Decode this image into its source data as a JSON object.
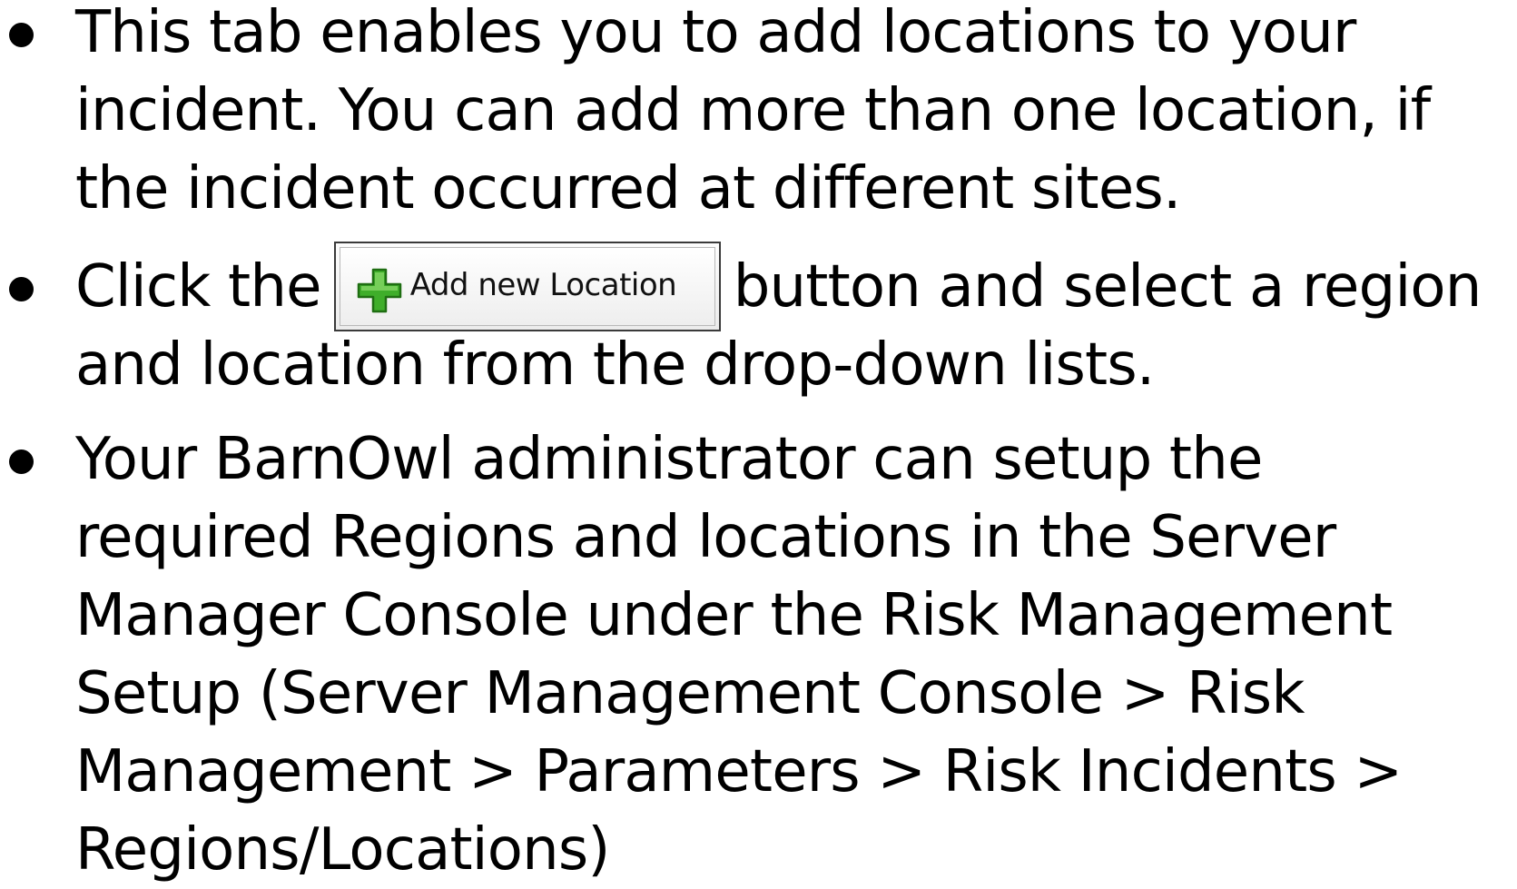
{
  "bullets": [
    {
      "lines": [
        "This tab enables you to add locations to your",
        "incident. You can add more than one location, if",
        "the incident occurred at different sites."
      ]
    },
    {
      "line1_before": "Click the",
      "button_label": "Add new Location",
      "button_icon": "green-plus-icon",
      "line1_after": "button and select a region",
      "line2": "and location from the drop-down lists."
    },
    {
      "lines": [
        "Your BarnOwl administrator can setup the",
        "required Regions and locations in the Server",
        "Manager Console under the Risk Management",
        "Setup (Server Management Console > Risk",
        "Management > Parameters > Risk Incidents >",
        "Regions/Locations)"
      ]
    }
  ],
  "colors": {
    "text": "#000000",
    "background": "#ffffff",
    "plus_green": "#3fae2a"
  }
}
